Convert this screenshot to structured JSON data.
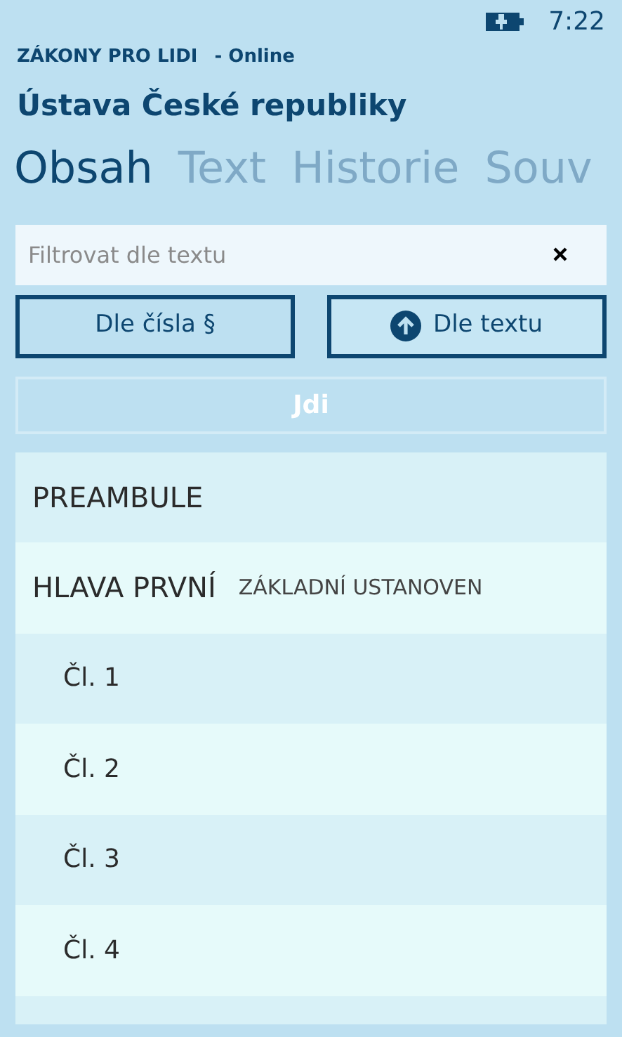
{
  "status_bar": {
    "time": "7:22"
  },
  "app": {
    "name": "ZÁKONY PRO LIDI",
    "status": "- Online"
  },
  "title": "Ústava České republiky",
  "tabs": [
    {
      "label": "Obsah",
      "selected": true
    },
    {
      "label": "Text",
      "selected": false
    },
    {
      "label": "Historie",
      "selected": false
    },
    {
      "label": "Souv",
      "selected": false
    }
  ],
  "search": {
    "placeholder": "Filtrovat dle textu"
  },
  "sort_buttons": [
    {
      "label": "Dle čísla §",
      "selected": false
    },
    {
      "label": "Dle textu",
      "selected": true
    }
  ],
  "go_button": {
    "label": "Jdi",
    "disabled": true
  },
  "outline": [
    {
      "title": "PREAMBULE"
    },
    {
      "title": "HLAVA PRVNÍ",
      "subtitle": "ZÁKLADNÍ USTANOVEN",
      "children": [
        {
          "title": "Čl. 1"
        },
        {
          "title": "Čl. 2"
        },
        {
          "title": "Čl. 3"
        },
        {
          "title": "Čl. 4"
        }
      ]
    }
  ]
}
